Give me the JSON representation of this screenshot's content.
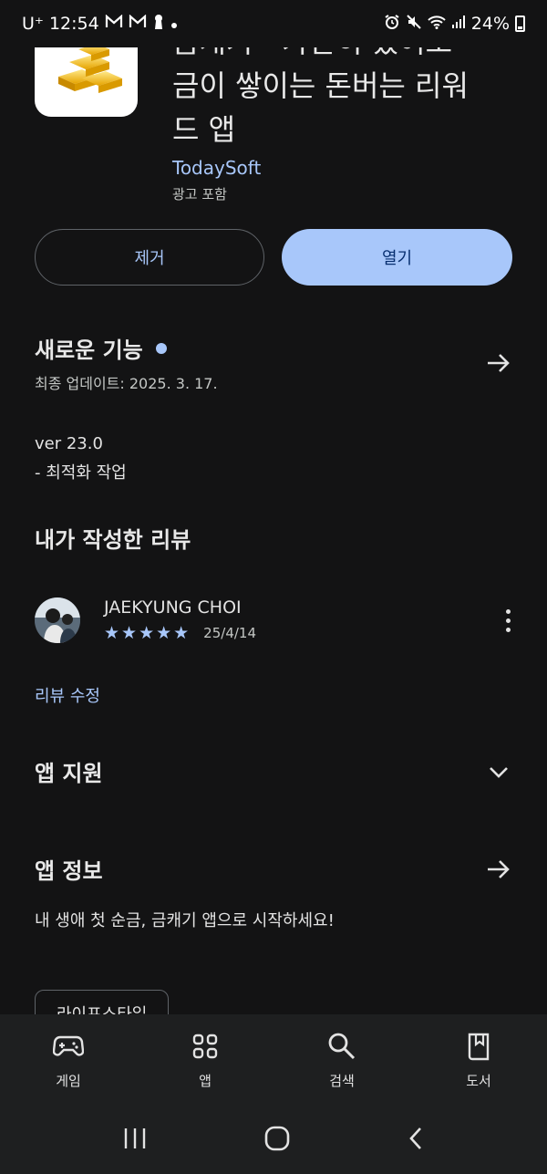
{
  "status_bar": {
    "carrier": "U⁺",
    "time": "12:54",
    "battery": "24%"
  },
  "app": {
    "title": "금캐기 - 가만히 있어도 금이 쌓이는 돈버는 리워드 앱",
    "developer": "TodaySoft",
    "ads_note": "광고 포함"
  },
  "actions": {
    "uninstall_label": "제거",
    "open_label": "열기"
  },
  "whats_new": {
    "title": "새로운 기능",
    "last_updated": "최종 업데이트: 2025. 3. 17.",
    "version": "ver 23.0",
    "notes": "- 최적화 작업"
  },
  "my_review": {
    "title": "내가 작성한 리뷰",
    "reviewer": "JAEKYUNG CHOI",
    "stars": "★★★★★",
    "rating": 5,
    "date": "25/4/14",
    "edit_label": "리뷰 수정"
  },
  "app_support": {
    "title": "앱 지원"
  },
  "about": {
    "title": "앱 정보",
    "description": "내 생애 첫 순금, 금캐기 앱으로 시작하세요!",
    "category_chip": "라이프스타일"
  },
  "bottom_nav": [
    {
      "label": "게임",
      "icon": "gamepad-icon"
    },
    {
      "label": "앱",
      "icon": "apps-grid-icon"
    },
    {
      "label": "검색",
      "icon": "search-icon"
    },
    {
      "label": "도서",
      "icon": "book-icon"
    }
  ],
  "colors": {
    "background": "#131314",
    "accent": "#a8c7fa",
    "nav_background": "#1e1f20"
  }
}
